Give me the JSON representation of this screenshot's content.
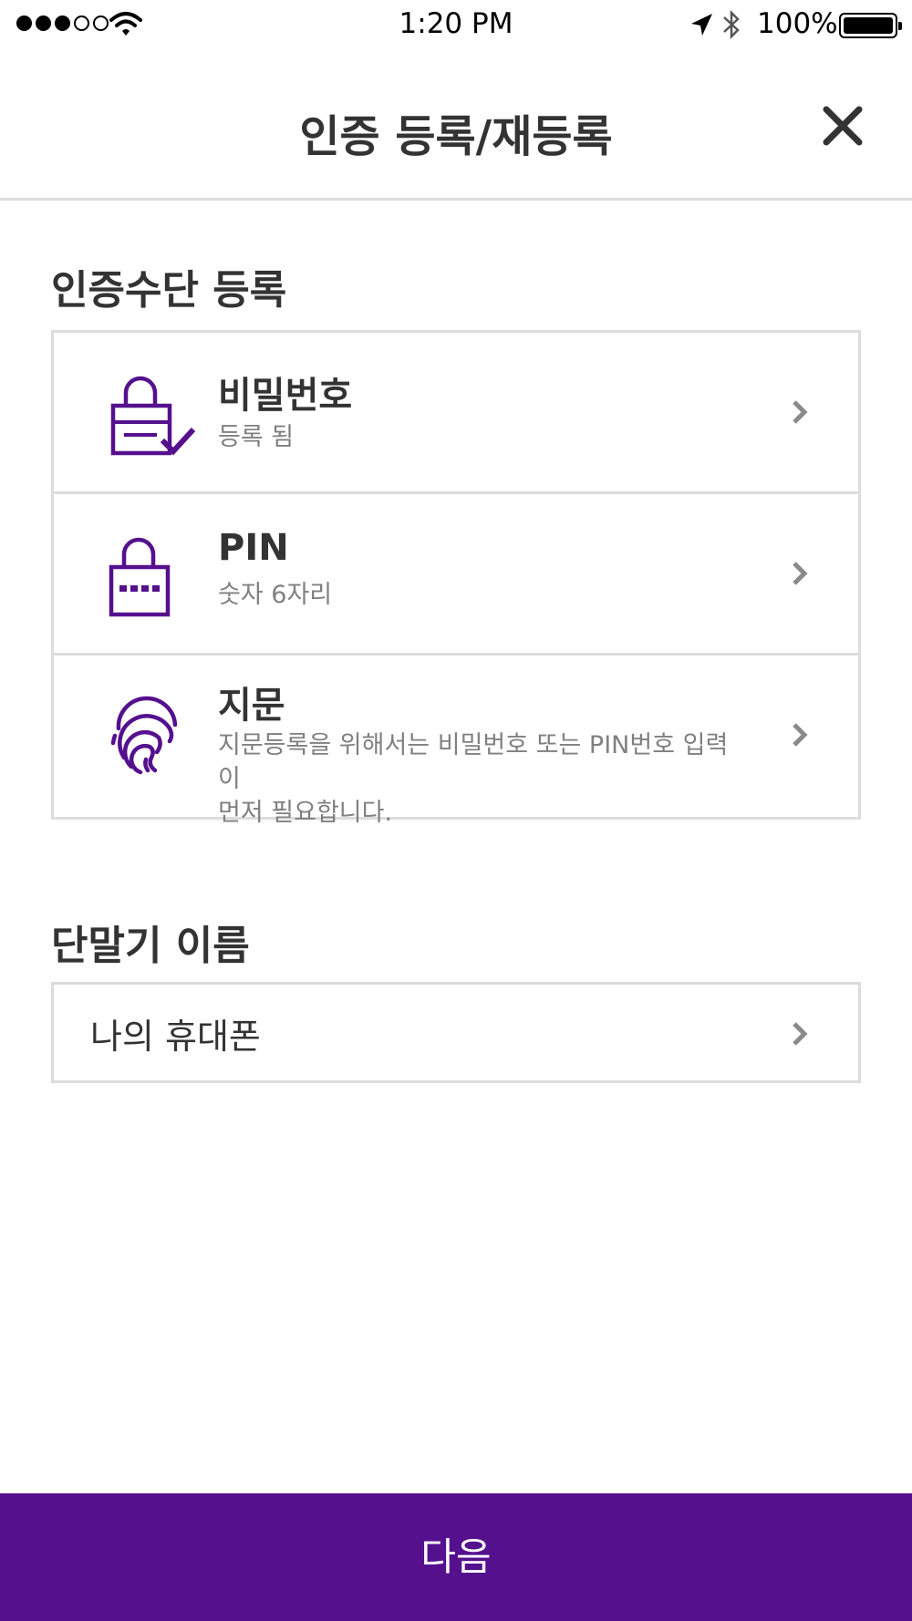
{
  "status_bar": {
    "time": "1:20 PM",
    "battery": "100%",
    "icons": [
      "signal-dots-icon",
      "wifi-icon",
      "location-arrow-icon",
      "bluetooth-icon",
      "battery-icon"
    ]
  },
  "header": {
    "title": "인증 등록/재등록",
    "close_icon": "close-icon"
  },
  "auth_section": {
    "title": "인증수단 등록",
    "items": [
      {
        "name": "비밀번호",
        "desc": "등록 됨",
        "icon": "lock-check-icon"
      },
      {
        "name": "PIN",
        "desc": "숫자 6자리",
        "icon": "lock-pin-icon"
      },
      {
        "name": "지문",
        "desc_line1": "지문등록을 위해서는 비밀번호 또는 PIN번호 입력이",
        "desc_line2": "먼저 필요합니다.",
        "icon": "fingerprint-icon"
      }
    ]
  },
  "device_section": {
    "title": "단말기 이름",
    "device_name": "나의 휴대폰"
  },
  "footer": {
    "next_label": "다음"
  },
  "colors": {
    "accent": "#55108e",
    "text": "#333333",
    "subtext": "#808080",
    "border": "#dcdcdc"
  }
}
